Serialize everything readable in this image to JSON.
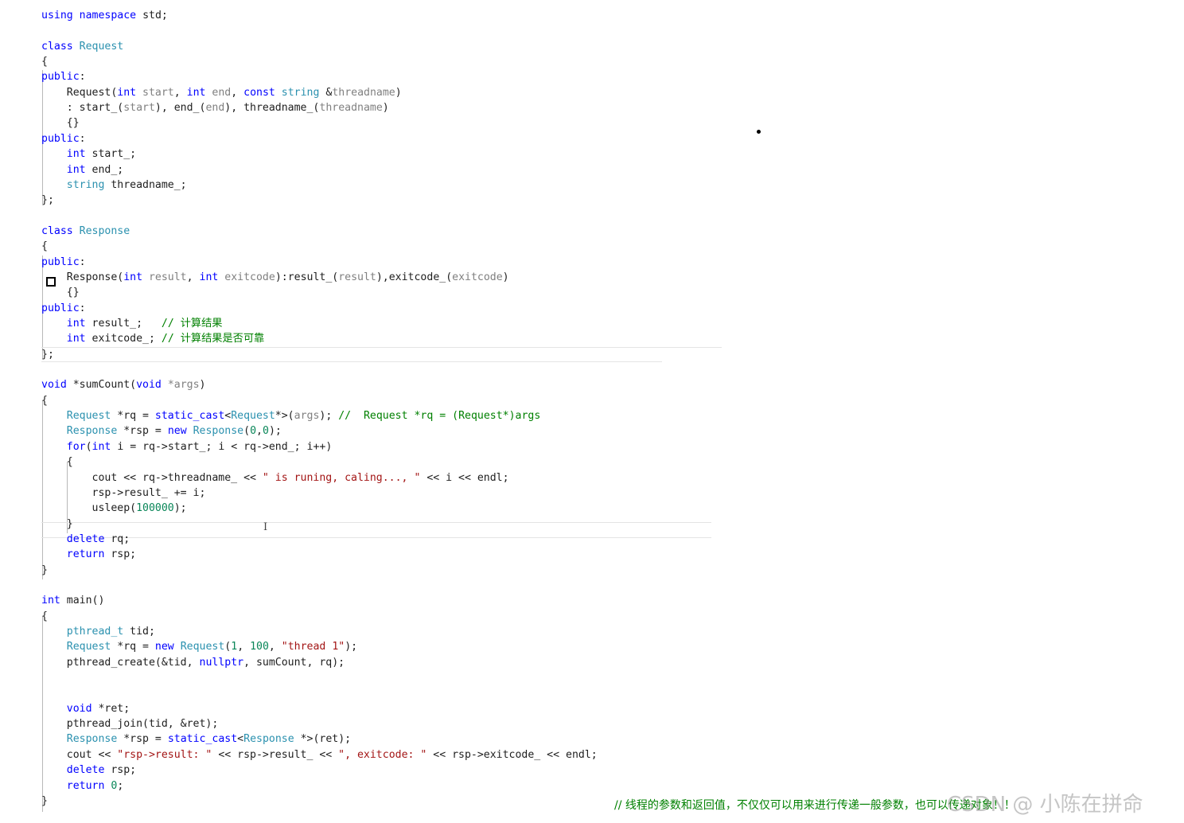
{
  "colors": {
    "keyword": "#0000ff",
    "type": "#2b91af",
    "string": "#a31515",
    "number": "#098658",
    "comment": "#008000",
    "parameter": "#808080",
    "text": "#1e1e1e"
  },
  "code_lines": [
    [
      [
        "kw",
        "using"
      ],
      [
        "p",
        " "
      ],
      [
        "kw",
        "namespace"
      ],
      [
        "p",
        " std;"
      ]
    ],
    [],
    [
      [
        "kw",
        "class"
      ],
      [
        "p",
        " "
      ],
      [
        "type",
        "Request"
      ]
    ],
    [
      [
        "p",
        "{"
      ]
    ],
    [
      [
        "kw",
        "public"
      ],
      [
        "p",
        ":"
      ]
    ],
    [
      [
        "p",
        "    Request("
      ],
      [
        "kw",
        "int"
      ],
      [
        "param",
        " start"
      ],
      [
        "p",
        ", "
      ],
      [
        "kw",
        "int"
      ],
      [
        "param",
        " end"
      ],
      [
        "p",
        ", "
      ],
      [
        "kw",
        "const"
      ],
      [
        "p",
        " "
      ],
      [
        "type",
        "string"
      ],
      [
        "p",
        " &"
      ],
      [
        "param",
        "threadname"
      ],
      [
        "p",
        ")"
      ]
    ],
    [
      [
        "p",
        "    : start_("
      ],
      [
        "param",
        "start"
      ],
      [
        "p",
        "), end_("
      ],
      [
        "param",
        "end"
      ],
      [
        "p",
        "), threadname_("
      ],
      [
        "param",
        "threadname"
      ],
      [
        "p",
        ")"
      ]
    ],
    [
      [
        "p",
        "    {}"
      ]
    ],
    [
      [
        "kw",
        "public"
      ],
      [
        "p",
        ":"
      ]
    ],
    [
      [
        "p",
        "    "
      ],
      [
        "kw",
        "int"
      ],
      [
        "p",
        " start_;"
      ]
    ],
    [
      [
        "p",
        "    "
      ],
      [
        "kw",
        "int"
      ],
      [
        "p",
        " end_;"
      ]
    ],
    [
      [
        "p",
        "    "
      ],
      [
        "type",
        "string"
      ],
      [
        "p",
        " threadname_;"
      ]
    ],
    [
      [
        "p",
        "};"
      ]
    ],
    [],
    [
      [
        "kw",
        "class"
      ],
      [
        "p",
        " "
      ],
      [
        "type",
        "Response"
      ]
    ],
    [
      [
        "p",
        "{"
      ]
    ],
    [
      [
        "kw",
        "public"
      ],
      [
        "p",
        ":"
      ]
    ],
    [
      [
        "p",
        "    Response("
      ],
      [
        "kw",
        "int"
      ],
      [
        "param",
        " result"
      ],
      [
        "p",
        ", "
      ],
      [
        "kw",
        "int"
      ],
      [
        "param",
        " exitcode"
      ],
      [
        "p",
        "):result_("
      ],
      [
        "param",
        "result"
      ],
      [
        "p",
        "),exitcode_("
      ],
      [
        "param",
        "exitcode"
      ],
      [
        "p",
        ")"
      ]
    ],
    [
      [
        "p",
        "    {}"
      ]
    ],
    [
      [
        "kw",
        "public"
      ],
      [
        "p",
        ":"
      ]
    ],
    [
      [
        "p",
        "    "
      ],
      [
        "kw",
        "int"
      ],
      [
        "p",
        " result_;   "
      ],
      [
        "cmt",
        "// 计算结果"
      ]
    ],
    [
      [
        "p",
        "    "
      ],
      [
        "kw",
        "int"
      ],
      [
        "p",
        " exitcode_; "
      ],
      [
        "cmt",
        "// 计算结果是否可靠"
      ]
    ],
    [
      [
        "p",
        "};"
      ]
    ],
    [],
    [
      [
        "kw",
        "void"
      ],
      [
        "p",
        " *sumCount("
      ],
      [
        "kw",
        "void"
      ],
      [
        "param",
        " *args"
      ],
      [
        "p",
        ")"
      ]
    ],
    [
      [
        "p",
        "{"
      ]
    ],
    [
      [
        "p",
        "    "
      ],
      [
        "type",
        "Request"
      ],
      [
        "p",
        " *rq = "
      ],
      [
        "kw",
        "static_cast"
      ],
      [
        "p",
        "<"
      ],
      [
        "type",
        "Request"
      ],
      [
        "p",
        "*>("
      ],
      [
        "param",
        "args"
      ],
      [
        "p",
        "); "
      ],
      [
        "cmt",
        "//  Request *rq = (Request*)args"
      ]
    ],
    [
      [
        "p",
        "    "
      ],
      [
        "type",
        "Response"
      ],
      [
        "p",
        " *rsp = "
      ],
      [
        "kw",
        "new"
      ],
      [
        "p",
        " "
      ],
      [
        "type",
        "Response"
      ],
      [
        "p",
        "("
      ],
      [
        "num",
        "0"
      ],
      [
        "p",
        ","
      ],
      [
        "num",
        "0"
      ],
      [
        "p",
        ");"
      ]
    ],
    [
      [
        "p",
        "    "
      ],
      [
        "kw",
        "for"
      ],
      [
        "p",
        "("
      ],
      [
        "kw",
        "int"
      ],
      [
        "p",
        " i = rq->start_; i < rq->end_; i++)"
      ]
    ],
    [
      [
        "p",
        "    {"
      ]
    ],
    [
      [
        "p",
        "        cout << rq->threadname_ << "
      ],
      [
        "str",
        "\" is runing, caling..., \""
      ],
      [
        "p",
        " << i << endl;"
      ]
    ],
    [
      [
        "p",
        "        rsp->result_ += i;"
      ]
    ],
    [
      [
        "p",
        "        usleep("
      ],
      [
        "num",
        "100000"
      ],
      [
        "p",
        ");"
      ]
    ],
    [
      [
        "p",
        "    }"
      ]
    ],
    [
      [
        "p",
        "    "
      ],
      [
        "kw",
        "delete"
      ],
      [
        "p",
        " rq;"
      ]
    ],
    [
      [
        "p",
        "    "
      ],
      [
        "kw",
        "return"
      ],
      [
        "p",
        " rsp;"
      ]
    ],
    [
      [
        "p",
        "}"
      ]
    ],
    [],
    [
      [
        "kw",
        "int"
      ],
      [
        "p",
        " main()"
      ]
    ],
    [
      [
        "p",
        "{"
      ]
    ],
    [
      [
        "p",
        "    "
      ],
      [
        "type",
        "pthread_t"
      ],
      [
        "p",
        " tid;"
      ]
    ],
    [
      [
        "p",
        "    "
      ],
      [
        "type",
        "Request"
      ],
      [
        "p",
        " *rq = "
      ],
      [
        "kw",
        "new"
      ],
      [
        "p",
        " "
      ],
      [
        "type",
        "Request"
      ],
      [
        "p",
        "("
      ],
      [
        "num",
        "1"
      ],
      [
        "p",
        ", "
      ],
      [
        "num",
        "100"
      ],
      [
        "p",
        ", "
      ],
      [
        "str",
        "\"thread 1\""
      ],
      [
        "p",
        ");"
      ]
    ],
    [
      [
        "p",
        "    pthread_create(&tid, "
      ],
      [
        "kw",
        "nullptr"
      ],
      [
        "p",
        ", sumCount, rq);"
      ]
    ],
    [],
    [],
    [
      [
        "p",
        "    "
      ],
      [
        "kw",
        "void"
      ],
      [
        "p",
        " *ret;"
      ]
    ],
    [
      [
        "p",
        "    pthread_join(tid, &ret);"
      ]
    ],
    [
      [
        "p",
        "    "
      ],
      [
        "type",
        "Response"
      ],
      [
        "p",
        " *rsp = "
      ],
      [
        "kw",
        "static_cast"
      ],
      [
        "p",
        "<"
      ],
      [
        "type",
        "Response"
      ],
      [
        "p",
        " *>(ret);"
      ]
    ],
    [
      [
        "p",
        "    cout << "
      ],
      [
        "str",
        "\"rsp->result: \""
      ],
      [
        "p",
        " << rsp->result_ << "
      ],
      [
        "str",
        "\", exitcode: \""
      ],
      [
        "p",
        " << rsp->exitcode_ << endl;"
      ]
    ],
    [
      [
        "p",
        "    "
      ],
      [
        "kw",
        "delete"
      ],
      [
        "p",
        " rsp;"
      ]
    ],
    [
      [
        "p",
        "    "
      ],
      [
        "kw",
        "return"
      ],
      [
        "p",
        " "
      ],
      [
        "num",
        "0"
      ],
      [
        "p",
        ";"
      ]
    ],
    [
      [
        "p",
        "}"
      ]
    ]
  ],
  "footer_comment": "// 线程的参数和返回值，不仅仅可以用来进行传递一般参数，也可以传递对象！！",
  "watermark": "CSDN @ 小陈在拼命",
  "icons": [
    "breakpoint-icon",
    "text-cursor-icon"
  ]
}
